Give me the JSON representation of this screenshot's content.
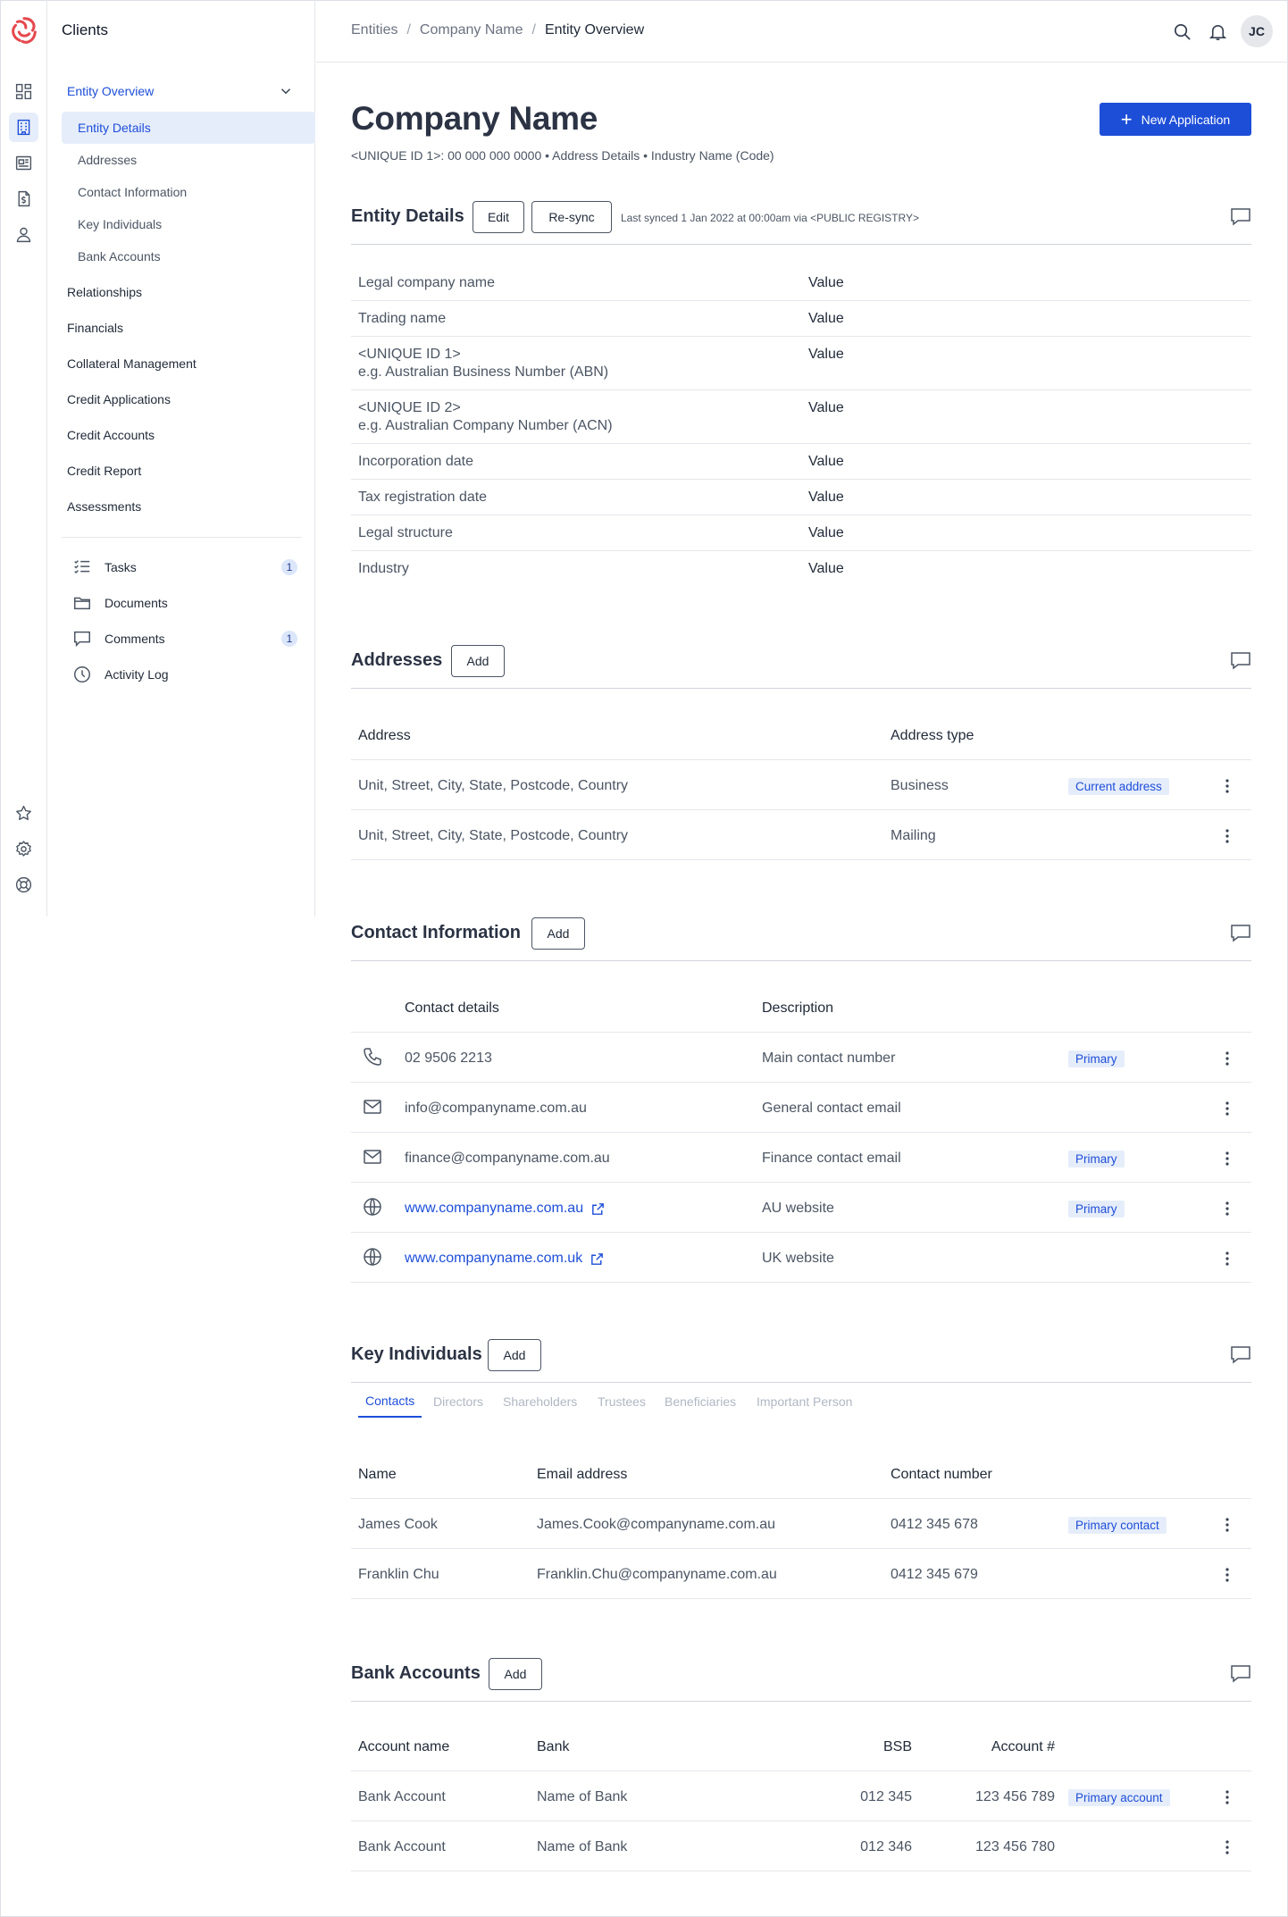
{
  "app": {
    "section_title": "Clients",
    "user_initials": "JC"
  },
  "breadcrumb": [
    "Entities",
    "Company Name",
    "Entity Overview"
  ],
  "sidebar": {
    "group": "Entity Overview",
    "subitems": [
      "Entity Details",
      "Addresses",
      "Contact Information",
      "Key Individuals",
      "Bank Accounts"
    ],
    "sections": [
      "Relationships",
      "Financials",
      "Collateral Management",
      "Credit Applications",
      "Credit Accounts",
      "Credit Report",
      "Assessments"
    ],
    "tools": [
      {
        "label": "Tasks",
        "count": "1"
      },
      {
        "label": "Documents",
        "count": ""
      },
      {
        "label": "Comments",
        "count": "1"
      },
      {
        "label": "Activity Log",
        "count": ""
      }
    ]
  },
  "page": {
    "title": "Company Name",
    "meta": "<UNIQUE ID 1>: 00 000 000 0000 • Address Details • Industry Name (Code)",
    "new_application": "New Application"
  },
  "entity_details": {
    "title": "Entity Details",
    "edit": "Edit",
    "resync": "Re-sync",
    "last_synced": "Last synced 1 Jan 2022 at 00:00am via <PUBLIC REGISTRY>",
    "rows": [
      {
        "label": "Legal company name",
        "sub": "",
        "value": "Value"
      },
      {
        "label": "Trading name",
        "sub": "",
        "value": "Value"
      },
      {
        "label": "<UNIQUE ID 1>",
        "sub": "e.g. Australian Business Number (ABN)",
        "value": "Value"
      },
      {
        "label": "<UNIQUE ID 2>",
        "sub": "e.g. Australian Company Number (ACN)",
        "value": "Value"
      },
      {
        "label": "Incorporation date",
        "sub": "",
        "value": "Value"
      },
      {
        "label": "Tax registration date",
        "sub": "",
        "value": "Value"
      },
      {
        "label": "Legal structure",
        "sub": "",
        "value": "Value"
      },
      {
        "label": "Industry",
        "sub": "",
        "value": "Value"
      }
    ]
  },
  "addresses": {
    "title": "Addresses",
    "add": "Add",
    "columns": [
      "Address",
      "Address type"
    ],
    "rows": [
      {
        "address": "Unit, Street, City, State, Postcode, Country",
        "type": "Business",
        "badge": "Current address"
      },
      {
        "address": "Unit, Street, City, State, Postcode, Country",
        "type": "Mailing",
        "badge": ""
      }
    ]
  },
  "contact_information": {
    "title": "Contact Information",
    "add": "Add",
    "columns": [
      "Contact details",
      "Description"
    ],
    "rows": [
      {
        "icon": "phone-icon",
        "detail": "02 9506 2213",
        "description": "Main contact number",
        "badge": "Primary",
        "link": false
      },
      {
        "icon": "mail-icon",
        "detail": "info@companyname.com.au",
        "description": "General contact email",
        "badge": "",
        "link": false
      },
      {
        "icon": "mail-icon",
        "detail": "finance@companyname.com.au",
        "description": "Finance contact email",
        "badge": "Primary",
        "link": false
      },
      {
        "icon": "globe-icon",
        "detail": "www.companyname.com.au",
        "description": "AU website",
        "badge": "Primary",
        "link": true
      },
      {
        "icon": "globe-icon",
        "detail": "www.companyname.com.uk",
        "description": "UK website",
        "badge": "",
        "link": true
      }
    ]
  },
  "key_individuals": {
    "title": "Key Individuals",
    "add": "Add",
    "tabs": [
      "Contacts",
      "Directors",
      "Shareholders",
      "Trustees",
      "Beneficiaries",
      "Important Person"
    ],
    "columns": [
      "Name",
      "Email address",
      "Contact number"
    ],
    "rows": [
      {
        "name": "James Cook",
        "email": "James.Cook@companyname.com.au",
        "phone": "0412 345 678",
        "badge": "Primary contact"
      },
      {
        "name": "Franklin Chu",
        "email": "Franklin.Chu@companyname.com.au",
        "phone": "0412 345 679",
        "badge": ""
      }
    ]
  },
  "bank_accounts": {
    "title": "Bank Accounts",
    "add": "Add",
    "columns": [
      "Account name",
      "Bank",
      "BSB",
      "Account #"
    ],
    "rows": [
      {
        "name": "Bank Account",
        "bank": "Name of Bank",
        "bsb": "012 345",
        "account": "123 456 789",
        "badge": "Primary account"
      },
      {
        "name": "Bank Account",
        "bank": "Name of Bank",
        "bsb": "012 346",
        "account": "123 456 780",
        "badge": ""
      }
    ]
  },
  "colors": {
    "accent": "#1d4ed8",
    "badge_bg": "#e6edfa",
    "logo": "#e5484d"
  }
}
